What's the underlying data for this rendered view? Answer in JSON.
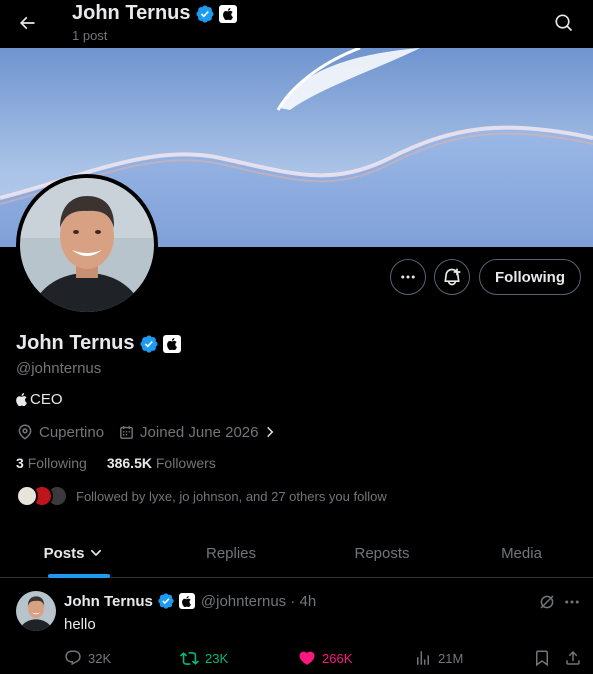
{
  "header": {
    "name": "John Ternus",
    "subtitle": "1 post"
  },
  "profile": {
    "name": "John Ternus",
    "handle": "@johnternus",
    "bio": "CEO",
    "location": "Cupertino",
    "joined": "Joined June 2026",
    "following_count": "3",
    "following_label": "Following",
    "followers_count": "386.5K",
    "followers_label": "Followers",
    "followed_by": "Followed by lyxe, jo johnson, and 27 others you follow",
    "follow_button": "Following"
  },
  "tabs": [
    {
      "label": "Posts",
      "active": true
    },
    {
      "label": "Replies"
    },
    {
      "label": "Reposts"
    },
    {
      "label": "Media"
    }
  ],
  "post": {
    "name": "John Ternus",
    "handle_time": "@johnternus · 4h",
    "text": "hello",
    "replies": "32K",
    "reposts": "23K",
    "likes": "266K",
    "views": "21M"
  },
  "colors": {
    "accent": "#1d9bf0",
    "verified": "#1d9bf0",
    "repost": "#00ba7c",
    "like": "#f91880",
    "muted": "#71767b"
  },
  "icons": [
    "back-arrow-icon",
    "search-icon",
    "verified-icon",
    "apple-logo-icon",
    "more-icon",
    "notification-plus-icon",
    "location-icon",
    "calendar-icon",
    "chevron-right-icon",
    "chevron-down-icon",
    "grok-icon",
    "reply-icon",
    "repost-icon",
    "heart-icon",
    "views-icon",
    "bookmark-icon",
    "share-icon"
  ]
}
